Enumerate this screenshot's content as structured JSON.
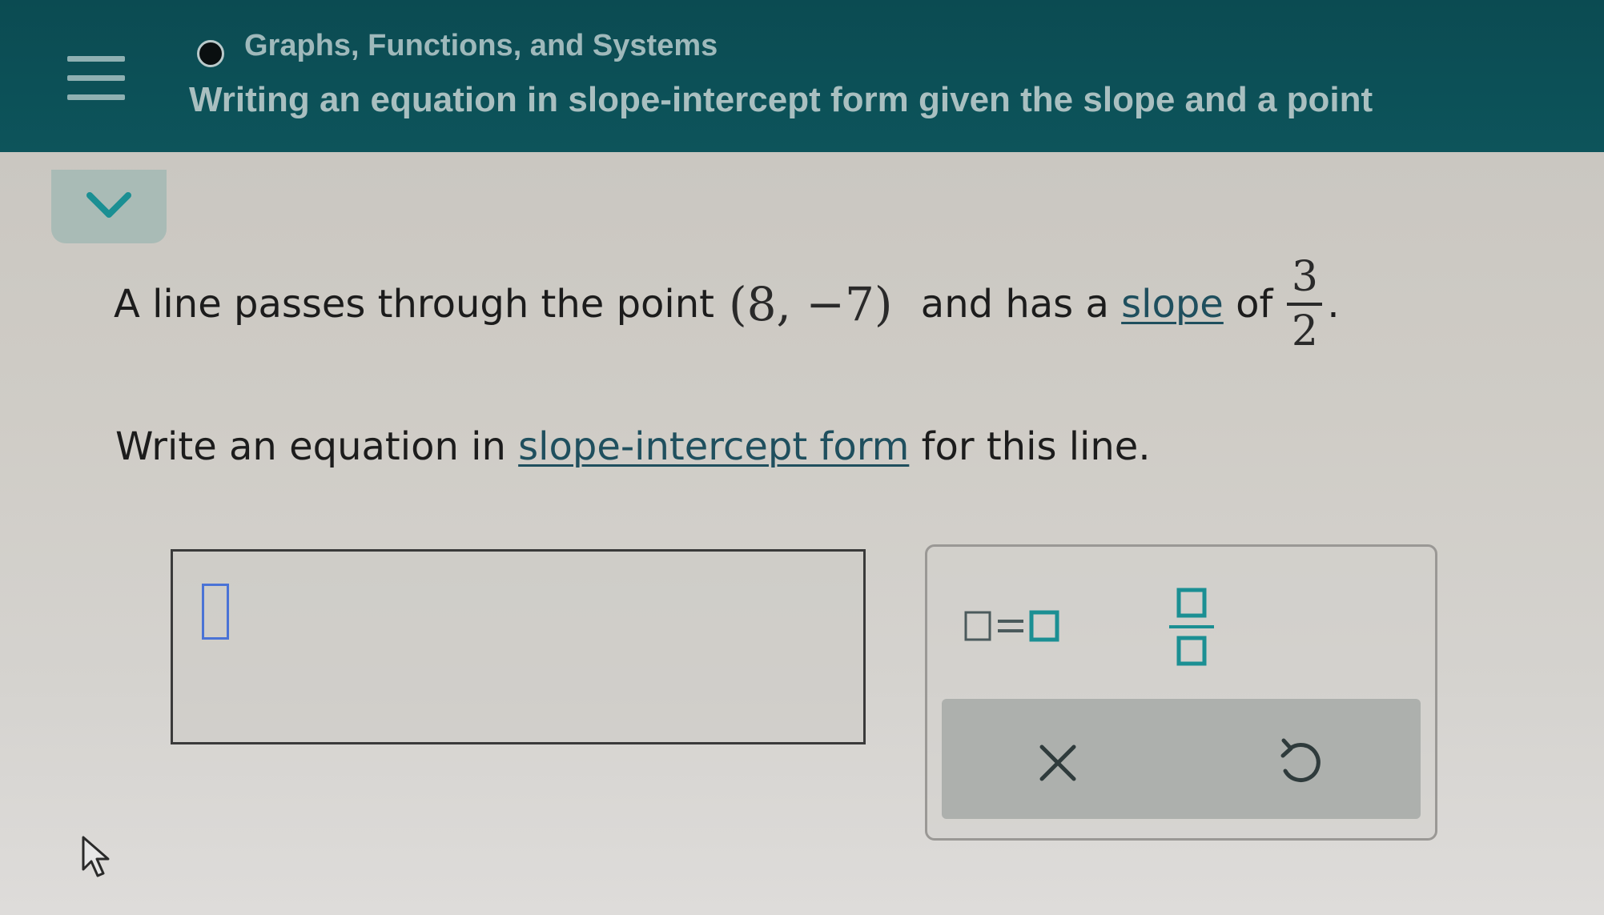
{
  "header": {
    "topic": "Graphs, Functions, and Systems",
    "lesson_title": "Writing an equation in slope-intercept form given the slope and a point",
    "menu_icon": "hamburger-menu-icon",
    "collapse_icon": "chevron-down-icon"
  },
  "problem": {
    "prefix": "A line passes through the point",
    "point": "(8, −7)",
    "middle": " and has a ",
    "slope_link": "slope",
    "of_text": " of",
    "slope_numerator": "3",
    "slope_denominator": "2",
    "period": "."
  },
  "instruction": {
    "prefix": "Write an equation in ",
    "link": "slope-intercept form",
    "suffix": " for this line."
  },
  "answer": {
    "value": ""
  },
  "keypad": {
    "equation_key": "equation-template-icon",
    "fraction_key": "fraction-template-icon",
    "clear_label": "×",
    "undo_icon": "undo-icon"
  },
  "colors": {
    "header_bg": "#0b4b52",
    "accent_teal": "#1b8f93",
    "link": "#1f4f5e",
    "cursor_blue": "#4a73d6"
  }
}
